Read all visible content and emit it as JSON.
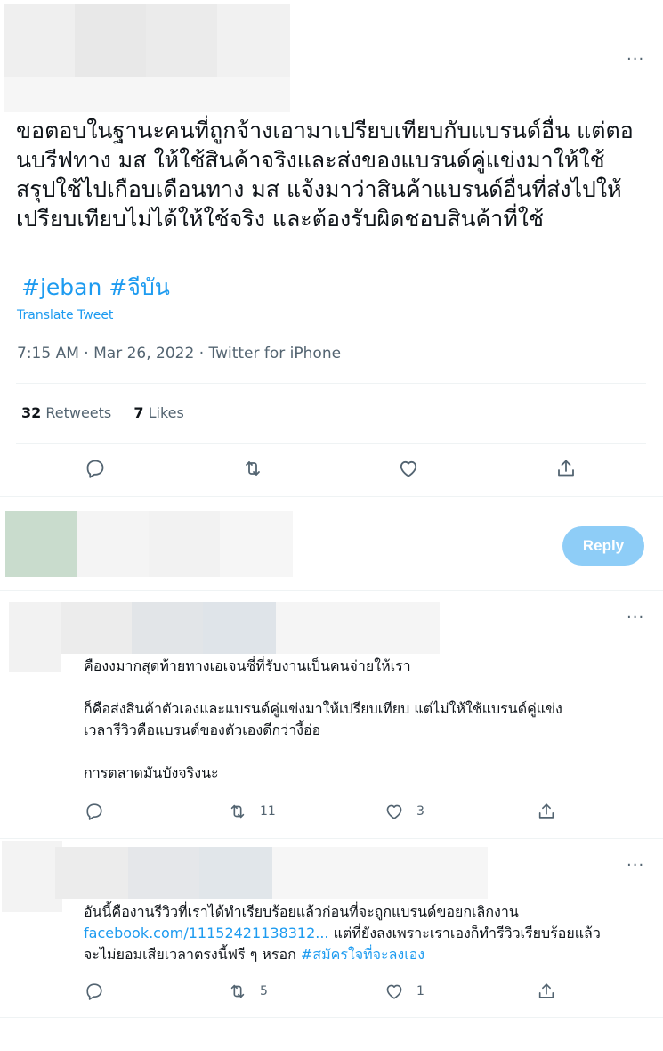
{
  "main_tweet": {
    "more_label": "···",
    "text": "ขอตอบในฐานะคนที่ถูกจ้างเอามาเปรียบเทียบกับแบรนด์อื่น แต่ตอนบรีฟทาง มส ให้ใช้สินค้าจริงและส่งของแบรนด์คู่แข่งมาให้ใช้สรุปใช้ไปเกือบเดือนทาง มส แจ้งมาว่าสินค้าแบรนด์อื่นที่ส่งไปให้เปรียบเทียบไม่ได้ให้ใช้จริง และต้องรับผิดชอบสินค้าที่ใช้",
    "hashtags": [
      "#jeban",
      "#จีบัน"
    ],
    "translate_label": "Translate Tweet",
    "time": "7:15 AM",
    "date": "Mar 26, 2022",
    "source": "Twitter for iPhone",
    "separator": "·",
    "retweets_count": "32",
    "retweets_label": "Retweets",
    "likes_count": "7",
    "likes_label": "Likes",
    "actions": [
      "reply-icon",
      "retweet-icon",
      "like-icon",
      "share-icon"
    ]
  },
  "compose": {
    "reply_label": "Reply"
  },
  "replies": [
    {
      "more_label": "···",
      "text": "คืองงมากสุดท้ายทางเอเจนซี่ที่รับงานเป็นคนจ่ายให้เรา\n\nก็คือส่งสินค้าตัวเองและแบรนด์คู่แข่งมาให้เปรียบเทียบ แต่ไม่ให้ใช้แบรนด์คู่แข่ง\nเวลารีวิวคือแบรนด์ของตัวเองดีกว่างี้อ่อ\n\nการตลาดมันบังจริงนะ",
      "retweets": "11",
      "likes": "3"
    },
    {
      "more_label": "···",
      "text_before": "อันนี้คืองานรีวิวที่เราได้ทำเรียบร้อยแล้วก่อนที่จะถูกแบรนด์ขอยกเลิกงาน\n",
      "link": "facebook.com/11152421138312...",
      "text_middle": " แต่ที่ยังลงเพราะเราเองก็ทำรีวิวเรียบร้อยแล้ว\nจะไม่ยอมเสียเวลาตรงนี้ฟรี ๆ หรอก ",
      "hashtag": "#สมัครใจที่จะลงเอง",
      "retweets": "5",
      "likes": "1"
    }
  ],
  "colors": {
    "accent": "#1d9bf0",
    "reply_button": "#8ecdf7",
    "muted_text": "#536471",
    "divider": "#eff3f4"
  }
}
